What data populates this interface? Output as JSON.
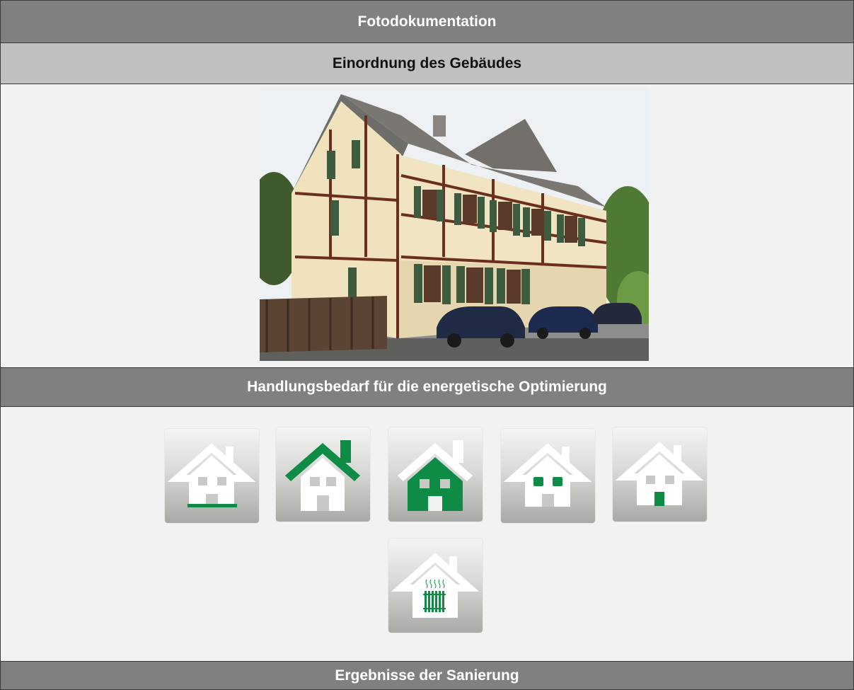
{
  "document": {
    "header": "Fotodokumentation",
    "section_building": "Einordnung des Gebäudes",
    "section_action": "Handlungsbedarf für die energetische Optimierung",
    "section_results": "Ergebnisse der Sanierung"
  },
  "photo": {
    "subject": "half-timbered-house-photo"
  },
  "measures": [
    {
      "icon": "house-floor-insulation-icon"
    },
    {
      "icon": "house-roof-insulation-icon"
    },
    {
      "icon": "house-wall-insulation-icon"
    },
    {
      "icon": "house-windows-icon"
    },
    {
      "icon": "house-door-icon"
    },
    {
      "icon": "house-heating-icon"
    }
  ],
  "colors": {
    "accent_green": "#0e8c45",
    "header_dark": "#808080",
    "header_light": "#c0c0c0",
    "background": "#f2f2f2"
  }
}
